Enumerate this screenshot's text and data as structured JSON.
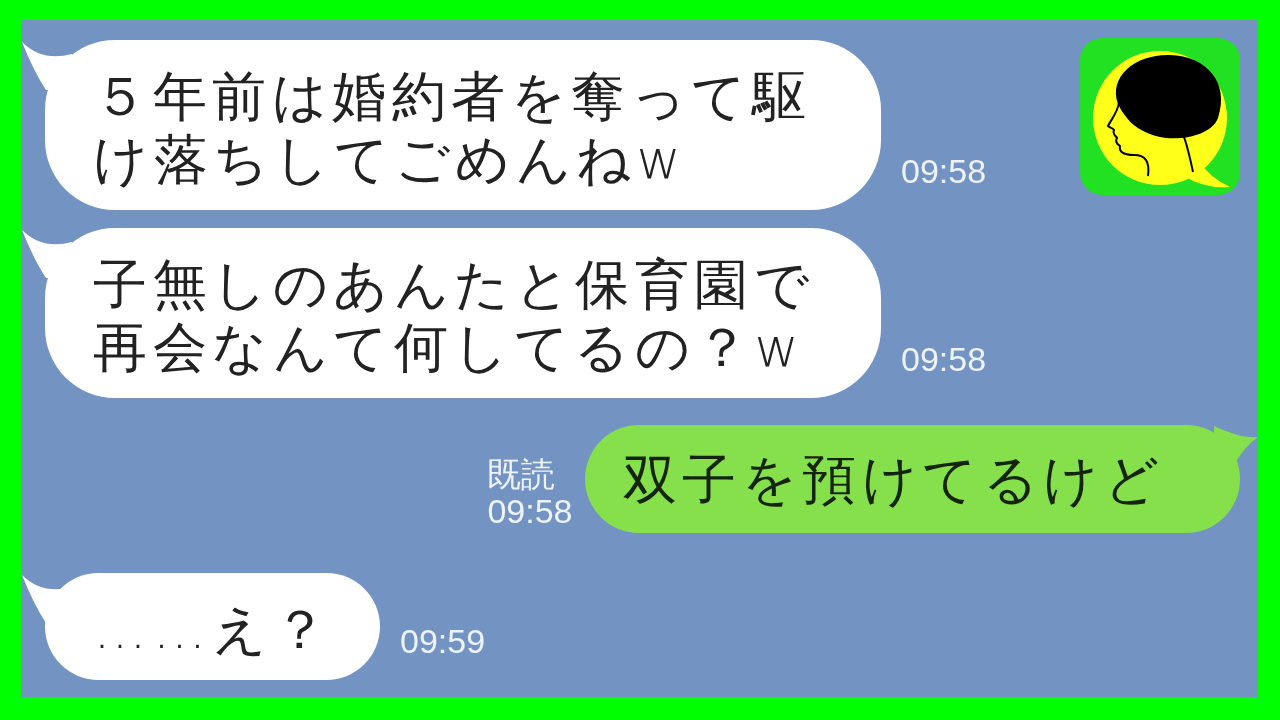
{
  "chat": {
    "messages": [
      {
        "kind": "received",
        "text": "５年前は婚約者を奪って駆け落ちしてごめんねw",
        "time": "09:58"
      },
      {
        "kind": "received",
        "text": "子無しのあんたと保育園で再会なんて何してるの？w",
        "time": "09:58"
      },
      {
        "kind": "sent",
        "text": "双子を預けてるけど",
        "read_status": "既読",
        "time": "09:58"
      },
      {
        "kind": "received",
        "text": "……え？",
        "time": "09:59"
      }
    ]
  }
}
